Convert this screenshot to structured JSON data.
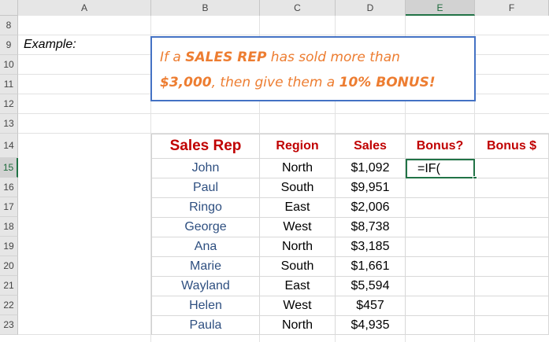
{
  "columns": [
    "A",
    "B",
    "C",
    "D",
    "E",
    "F"
  ],
  "rows": [
    "8",
    "9",
    "10",
    "11",
    "12",
    "13",
    "14",
    "15",
    "16",
    "17",
    "18",
    "19",
    "20",
    "21",
    "22",
    "23"
  ],
  "example_label": "Example:",
  "callout": {
    "line1_a": "If a ",
    "line1_b": "SALES REP",
    "line1_c": " has sold more than",
    "line2_a": "$3,000",
    "line2_b": ", then give them a ",
    "line2_c": "10% BONUS!"
  },
  "table": {
    "headers": [
      "Sales Rep",
      "Region",
      "Sales",
      "Bonus?",
      "Bonus $"
    ],
    "rows": [
      [
        "John",
        "North",
        "$1,092",
        "=IF(",
        ""
      ],
      [
        "Paul",
        "South",
        "$9,951",
        "",
        ""
      ],
      [
        "Ringo",
        "East",
        "$2,006",
        "",
        ""
      ],
      [
        "George",
        "West",
        "$8,738",
        "",
        ""
      ],
      [
        "Ana",
        "North",
        "$3,185",
        "",
        ""
      ],
      [
        "Marie",
        "South",
        "$1,661",
        "",
        ""
      ],
      [
        "Wayland",
        "East",
        "$5,594",
        "",
        ""
      ],
      [
        "Helen",
        "West",
        "$457",
        "",
        ""
      ],
      [
        "Paula",
        "North",
        "$4,935",
        "",
        ""
      ]
    ]
  },
  "colors": {
    "accent": "#217346",
    "header_text": "#c00000",
    "callout_text": "#ed7d31",
    "callout_border": "#4472c4",
    "rep_text": "#2e4f80"
  }
}
